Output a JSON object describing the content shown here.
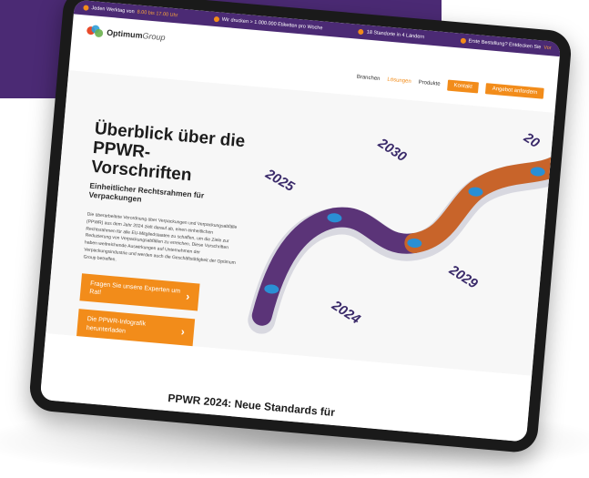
{
  "topbar": {
    "item1_prefix": "Jeden Werktag von",
    "item1_hours": "8.00 bis 17.00 Uhr",
    "item2": "Wir drucken > 1.000.000 Etiketten pro Woche",
    "item3": "18 Standorte in 4 Ländern",
    "item4": "Erste Bestellung? Entdecken Sie",
    "item4_accent": "Vor"
  },
  "logo": {
    "name": "Optimum",
    "suffix": "Group"
  },
  "nav": {
    "items": [
      "Branchen",
      "Lösungen",
      "Produkte"
    ],
    "contact": "Kontakt",
    "quote": "Angebot anfordern"
  },
  "hero": {
    "title": "Überblick über die PPWR-Vorschriften",
    "subtitle": "Einheitlicher Rechtsrahmen für Verpackungen",
    "description": "Die überarbeitete Verordnung über Verpackungen und Verpackungsabfälle (PPWR) aus dem Jahr 2024 zielt darauf ab, einen einheitlichen Rechtsrahmen für alle EU-Mitgliedstaaten zu schaffen, um die Ziele zur Reduzierung von Verpackungsabfällen zu erreichen. Diese Vorschriften haben weitreichende Auswirkungen auf Unternehmen der Verpackungsindustrie und werden auch die Geschäftstätigkeit der Optimum Group betreffen.",
    "cta_experts": "Fragen Sie unsere Experten um Rat!",
    "cta_download": "Die PPWR-Infografik herunterladen"
  },
  "roadmap": {
    "years": [
      "2024",
      "2025",
      "2029",
      "2030",
      "20"
    ],
    "colors": {
      "purple": "#5b3478",
      "orange": "#c8642a",
      "node": "#2a8fd4"
    }
  },
  "section": {
    "title": "PPWR 2024: Neue Standards für"
  },
  "colors": {
    "brand_purple": "#4b2a74",
    "accent_orange": "#f28c1a"
  }
}
